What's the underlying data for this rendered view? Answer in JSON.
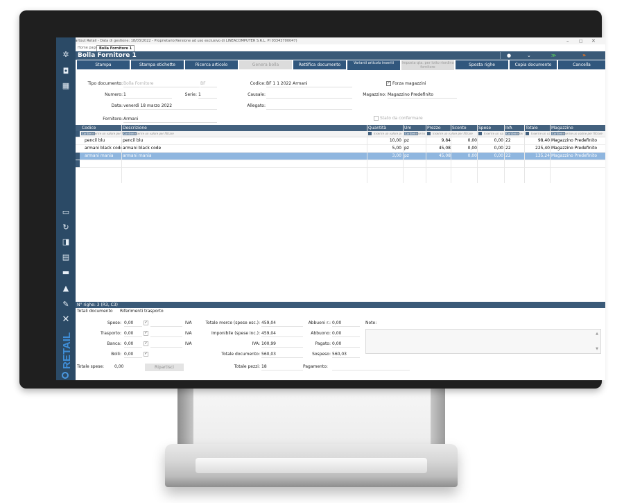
{
  "window": {
    "title": "Passepartout Retail - Data di gestione: 18/03/2022 - Proprietario(Versione ad uso esclusivo di LINEACOMPUTER S.R.L. PI 03343700047)",
    "controls": {
      "min": "–",
      "max": "◻",
      "close": "✕"
    }
  },
  "tabs": [
    {
      "label": "Home page"
    },
    {
      "label": "Bolla Fornitore 1"
    }
  ],
  "page_title": "Bolla Fornitore 1",
  "sidebar": {
    "brand": "RETAIL",
    "icons": [
      "gear-icon",
      "camera-icon",
      "grid-add-icon",
      "save-icon",
      "refresh-icon",
      "export-icon",
      "calculator-icon",
      "keyboard-icon",
      "lock-icon",
      "wrench-icon",
      "close-icon"
    ],
    "glyphs": {
      "gear": "✲",
      "camera": "◘",
      "grid": "▦",
      "save": "▭",
      "refresh": "↻",
      "export": "◨",
      "calc": "▤",
      "keyboard": "▬",
      "lock": "▲",
      "wrench": "✎",
      "close": "✕"
    }
  },
  "toolbar": {
    "buttons": [
      "Stampa",
      "Stampa etichette",
      "Ricerca articolo",
      "Genera bolla",
      "Rettifica documento",
      "Varianti articolo inseriti",
      "Imposta qta. per lotto riordino fornitore",
      "Sposta righe",
      "Copia documento",
      "Cancella"
    ],
    "header_icons": [
      "●",
      "⌄",
      "≫",
      "»"
    ]
  },
  "form": {
    "tipo_documento": {
      "label": "Tipo documento:",
      "value": "Bolla Fornitore",
      "code": "BF"
    },
    "numero": {
      "label": "Numero:",
      "value": "1"
    },
    "serie": {
      "label": "Serie:",
      "value": "1"
    },
    "data": {
      "label": "Data:",
      "value": "venerdì 18 marzo 2022"
    },
    "fornitore": {
      "label": "Fornitore:",
      "value": "Armani"
    },
    "codice": {
      "label": "Codice:",
      "value": "BF 1 1 2022 Armani"
    },
    "causale": {
      "label": "Causale:",
      "value": ""
    },
    "allegato": {
      "label": "Allegato:",
      "value": ""
    },
    "magazzino": {
      "label": "Magazzino:",
      "value": "Magazzino Predefinito"
    },
    "forza_magazzini": "Forza magazzini",
    "stato_da_confermare": "Stato da confermare"
  },
  "grid": {
    "columns": [
      "Codice",
      "Descrizione",
      "Quantità",
      "Um",
      "Prezzo",
      "Sconto",
      "Spese",
      "IVA",
      "Totale",
      "Magazzino"
    ],
    "filter_tag": "Contiene",
    "filter_placeholder": "Inserire un valore per filtrare",
    "rows": [
      {
        "codice": "pencil blu",
        "descrizione": "pencil blu",
        "quantita": "10,00",
        "um": "pz",
        "prezzo": "9,84",
        "sconto": "0,00",
        "spese": "0,00",
        "iva": "22",
        "totale": "98,40",
        "magazzino": "Magazzino Predefinito"
      },
      {
        "codice": "armani black code",
        "descrizione": "armani black code",
        "quantita": "5,00",
        "um": "pz",
        "prezzo": "45,08",
        "sconto": "0,00",
        "spese": "0,00",
        "iva": "22",
        "totale": "225,40",
        "magazzino": "Magazzino Predefinito"
      },
      {
        "codice": "armani mania",
        "descrizione": "armani mania",
        "quantita": "3,00",
        "um": "pz",
        "prezzo": "45,08",
        "sconto": "0,00",
        "spese": "0,00",
        "iva": "22",
        "totale": "135,24",
        "magazzino": "Magazzino Predefinito"
      }
    ]
  },
  "status": "N° righe: 3  (R3, C3)",
  "footer": {
    "tabs": [
      "Totali documento",
      "Riferimenti trasporto"
    ],
    "spese": {
      "label": "Spese:",
      "value": "0,00"
    },
    "trasporto": {
      "label": "Trasporto:",
      "value": "0,00"
    },
    "banca": {
      "label": "Banca:",
      "value": "0,00"
    },
    "bolli": {
      "label": "Bolli:",
      "value": "0,00"
    },
    "totale_spese": {
      "label": "Totale spese:",
      "value": "0,00"
    },
    "iva_label": "IVA",
    "ripartisci": "Ripartisci",
    "totale_merce": {
      "label": "Totale merce (spese esc.):",
      "value": "459,04"
    },
    "imponibile": {
      "label": "Imponibile (spese inc.):",
      "value": "459,04"
    },
    "iva": {
      "label": "IVA:",
      "value": "100,99"
    },
    "totale_documento": {
      "label": "Totale documento:",
      "value": "560,03"
    },
    "totale_pezzi": {
      "label": "Totale pezzi:",
      "value": "18"
    },
    "abbuoni_r": {
      "label": "Abbuoni r.:",
      "value": "0,00"
    },
    "abbuono": {
      "label": "Abbuono:",
      "value": "0,00"
    },
    "pagato": {
      "label": "Pagato:",
      "value": "0,00"
    },
    "sospeso": {
      "label": "Sospeso:",
      "value": "560,03"
    },
    "pagamento": {
      "label": "Pagamento:",
      "value": ""
    },
    "note": {
      "label": "Note:"
    }
  }
}
